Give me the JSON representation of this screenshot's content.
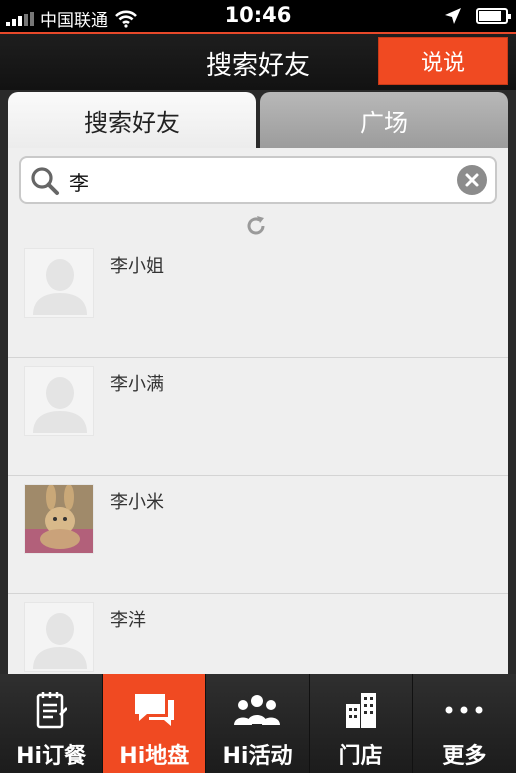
{
  "status_bar": {
    "carrier": "中国联通",
    "time": "10:46"
  },
  "nav": {
    "title": "搜索好友",
    "action_label": "说说"
  },
  "tabs": [
    {
      "label": "搜索好友",
      "active": true
    },
    {
      "label": "广场",
      "active": false
    }
  ],
  "search": {
    "value": "李"
  },
  "results": [
    {
      "name": "李小姐",
      "avatar": "default-avatar"
    },
    {
      "name": "李小满",
      "avatar": "default-avatar"
    },
    {
      "name": "李小米",
      "avatar": "photo-avatar"
    },
    {
      "name": "李洋",
      "avatar": "default-avatar"
    }
  ],
  "tab_bar": [
    {
      "label": "Hi订餐",
      "icon": "menu-notepad-icon",
      "active": false
    },
    {
      "label": "Hi地盘",
      "icon": "chat-bubbles-icon",
      "active": true
    },
    {
      "label": "Hi活动",
      "icon": "people-group-icon",
      "active": false
    },
    {
      "label": "门店",
      "icon": "building-icon",
      "active": false
    },
    {
      "label": "更多",
      "icon": "more-dots-icon",
      "active": false
    }
  ],
  "colors": {
    "accent": "#f04a22",
    "panel": "#efefef",
    "dark": "#1e1e1e"
  }
}
